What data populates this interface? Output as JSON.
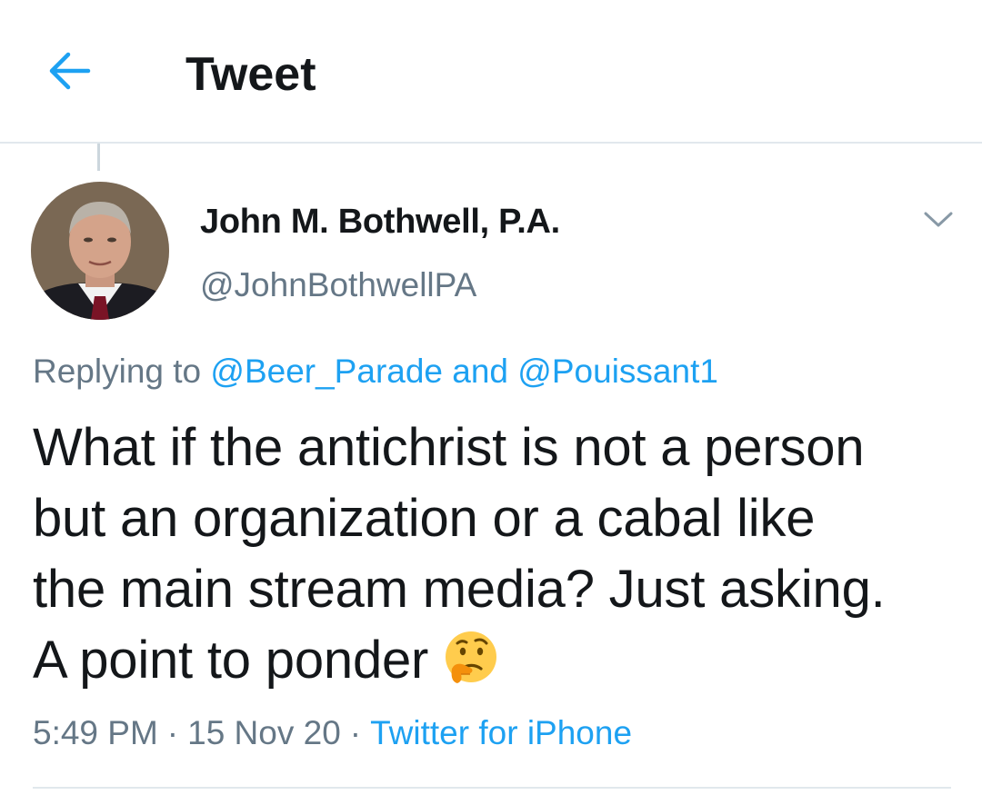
{
  "header": {
    "title": "Tweet",
    "back_icon": "arrow-left-icon"
  },
  "colors": {
    "accent": "#1da1f2",
    "text_primary": "#14171a",
    "text_secondary": "#657786",
    "divider": "#e1e8ed"
  },
  "tweet": {
    "author": {
      "display_name": "John M. Bothwell, P.A.",
      "handle": "@JohnBothwellPA",
      "avatar_icon": "profile-photo"
    },
    "caret_icon": "chevron-down-icon",
    "replying": {
      "prefix": "Replying to ",
      "first_mention": "@Beer_Parade",
      "conjunction": " and ",
      "second_mention": "@Pouissant1"
    },
    "text_lines": [
      "What if the antichrist is not a person",
      "but an organization or a cabal like",
      "the main stream media? Just asking.",
      "A point to ponder"
    ],
    "emoji_icon": "thinking-face-emoji",
    "time": "5:49 PM",
    "separator": "·",
    "date": "15 Nov 20",
    "source": "Twitter for iPhone"
  }
}
